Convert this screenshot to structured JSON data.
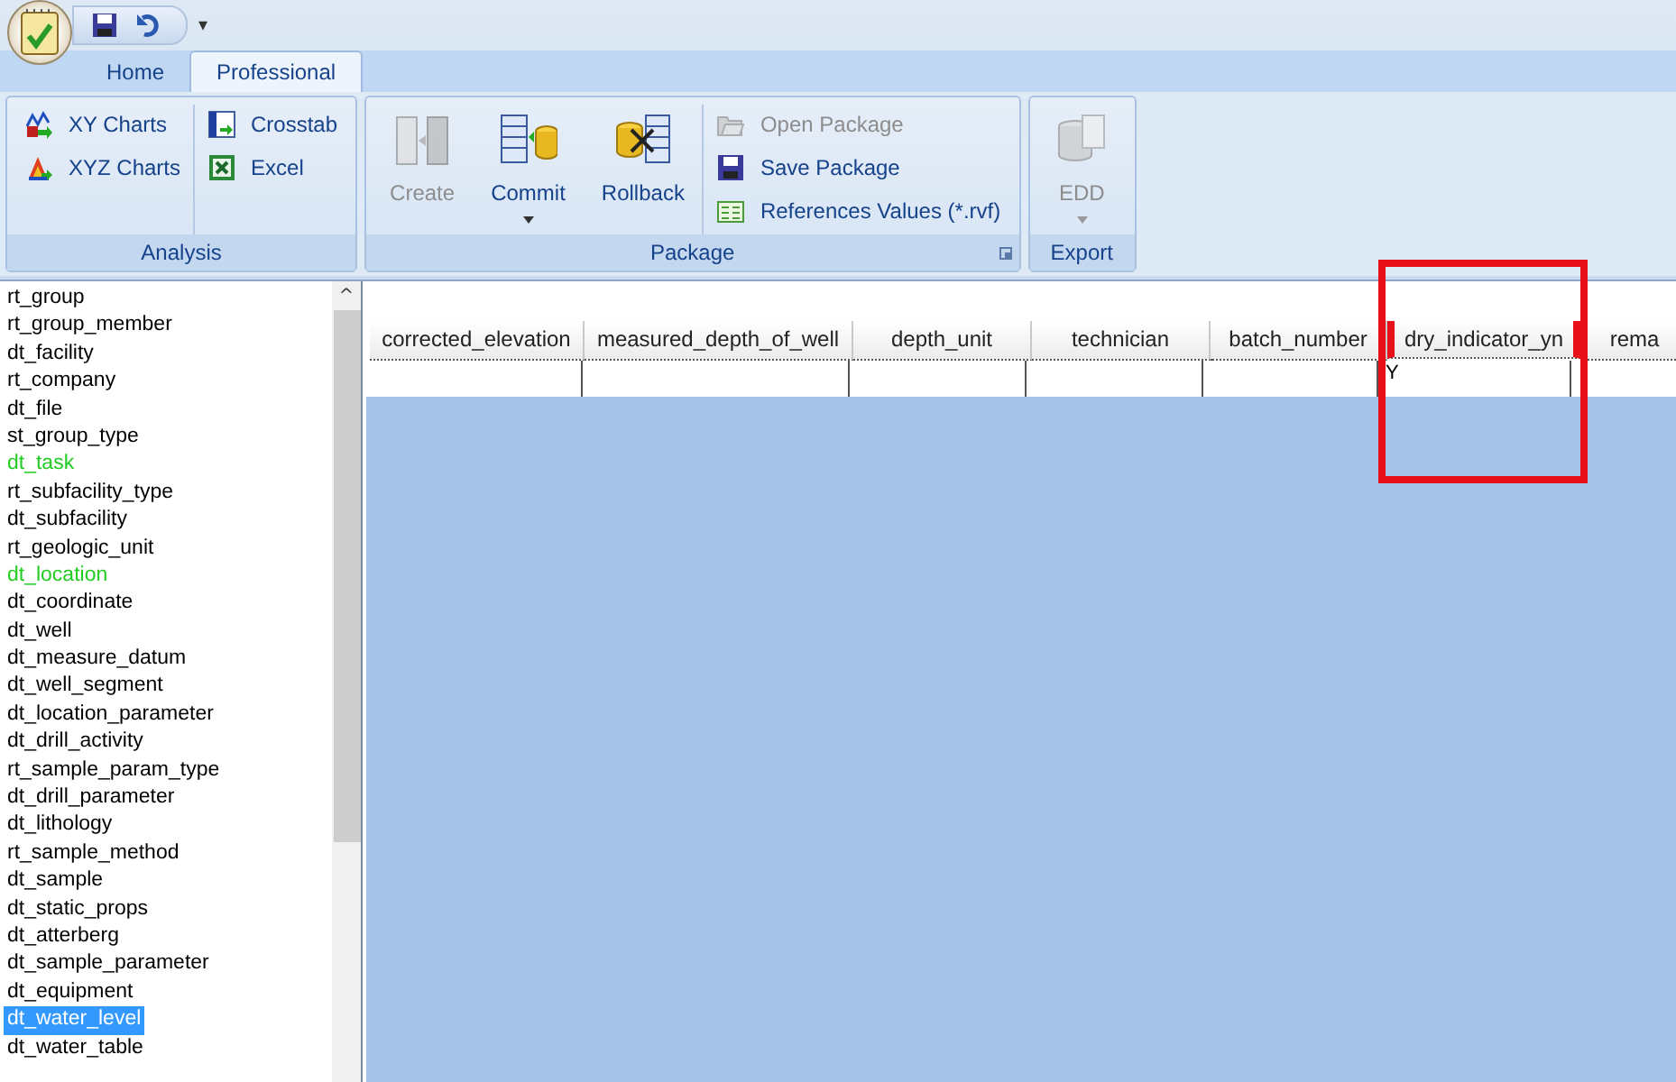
{
  "quick_access": {
    "menu_glyph": "▾"
  },
  "tabs": [
    {
      "label": "Home",
      "selected": false
    },
    {
      "label": "Professional",
      "selected": true
    }
  ],
  "ribbon_groups": [
    {
      "title": "Analysis",
      "has_launcher": false,
      "columns": [
        [
          {
            "label": "XY Charts",
            "kind": "small",
            "disabled": false,
            "dropdown": false
          },
          {
            "label": "XYZ Charts",
            "kind": "small",
            "disabled": false,
            "dropdown": false
          }
        ],
        [
          {
            "label": "Crosstab",
            "kind": "small",
            "disabled": false,
            "dropdown": false
          },
          {
            "label": "Excel",
            "kind": "small",
            "disabled": false,
            "dropdown": false
          }
        ]
      ]
    },
    {
      "title": "Package",
      "has_launcher": true,
      "columns": [
        [
          {
            "label": "Create",
            "kind": "large",
            "disabled": true,
            "dropdown": false
          }
        ],
        [
          {
            "label": "Commit",
            "kind": "large",
            "disabled": false,
            "dropdown": true
          }
        ],
        [
          {
            "label": "Rollback",
            "kind": "large",
            "disabled": false,
            "dropdown": false
          }
        ],
        [
          {
            "label": "Open Package",
            "kind": "small",
            "disabled": true,
            "dropdown": false
          },
          {
            "label": "Save Package",
            "kind": "small",
            "disabled": false,
            "dropdown": false
          },
          {
            "label": "References Values (*.rvf)",
            "kind": "small",
            "disabled": false,
            "dropdown": false
          }
        ]
      ]
    },
    {
      "title": "Export",
      "has_launcher": false,
      "columns": [
        [
          {
            "label": "EDD",
            "kind": "large",
            "disabled": true,
            "dropdown": true
          }
        ]
      ]
    }
  ],
  "table_list": {
    "scroll_up_glyph": "^",
    "items": [
      {
        "label": "rt_group",
        "color": "#000000",
        "selected": false
      },
      {
        "label": "rt_group_member",
        "color": "#000000",
        "selected": false
      },
      {
        "label": "dt_facility",
        "color": "#000000",
        "selected": false
      },
      {
        "label": "rt_company",
        "color": "#000000",
        "selected": false
      },
      {
        "label": "dt_file",
        "color": "#000000",
        "selected": false
      },
      {
        "label": "st_group_type",
        "color": "#000000",
        "selected": false
      },
      {
        "label": "dt_task",
        "color": "#22cc22",
        "selected": false
      },
      {
        "label": "rt_subfacility_type",
        "color": "#000000",
        "selected": false
      },
      {
        "label": "dt_subfacility",
        "color": "#000000",
        "selected": false
      },
      {
        "label": "rt_geologic_unit",
        "color": "#000000",
        "selected": false
      },
      {
        "label": "dt_location",
        "color": "#22cc22",
        "selected": false
      },
      {
        "label": "dt_coordinate",
        "color": "#000000",
        "selected": false
      },
      {
        "label": "dt_well",
        "color": "#000000",
        "selected": false
      },
      {
        "label": "dt_measure_datum",
        "color": "#000000",
        "selected": false
      },
      {
        "label": "dt_well_segment",
        "color": "#000000",
        "selected": false
      },
      {
        "label": "dt_location_parameter",
        "color": "#000000",
        "selected": false
      },
      {
        "label": "dt_drill_activity",
        "color": "#000000",
        "selected": false
      },
      {
        "label": "rt_sample_param_type",
        "color": "#000000",
        "selected": false
      },
      {
        "label": "dt_drill_parameter",
        "color": "#000000",
        "selected": false
      },
      {
        "label": "dt_lithology",
        "color": "#000000",
        "selected": false
      },
      {
        "label": "rt_sample_method",
        "color": "#000000",
        "selected": false
      },
      {
        "label": "dt_sample",
        "color": "#000000",
        "selected": false
      },
      {
        "label": "dt_static_props",
        "color": "#000000",
        "selected": false
      },
      {
        "label": "dt_atterberg",
        "color": "#000000",
        "selected": false
      },
      {
        "label": "dt_sample_parameter",
        "color": "#000000",
        "selected": false
      },
      {
        "label": "dt_equipment",
        "color": "#000000",
        "selected": false
      },
      {
        "label": "dt_water_level",
        "color": "#ffffff",
        "selected": true
      },
      {
        "label": "dt_water_table",
        "color": "#000000",
        "selected": false
      }
    ]
  },
  "grid": {
    "columns": [
      {
        "label": "corrected_elevation",
        "highlighted": false
      },
      {
        "label": "measured_depth_of_well",
        "highlighted": false
      },
      {
        "label": "depth_unit",
        "highlighted": false
      },
      {
        "label": "technician",
        "highlighted": false
      },
      {
        "label": "batch_number",
        "highlighted": false
      },
      {
        "label": "dry_indicator_yn",
        "highlighted": true
      },
      {
        "label": "rema",
        "highlighted": false
      }
    ],
    "rows": [
      [
        "",
        "",
        "",
        "",
        "",
        "Y",
        ""
      ]
    ]
  }
}
